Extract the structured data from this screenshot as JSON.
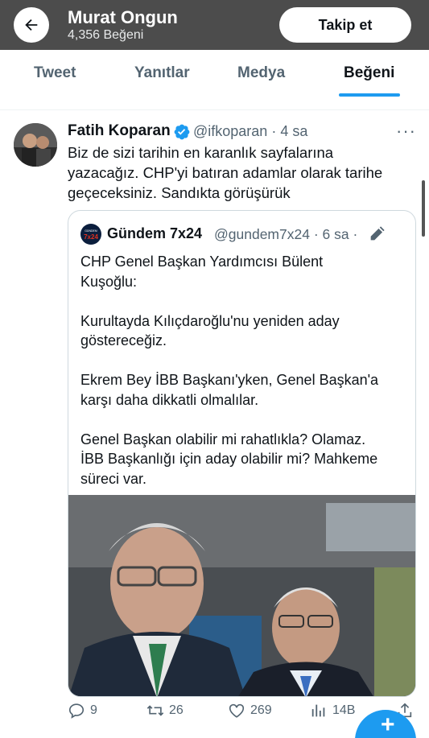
{
  "header": {
    "name": "Murat Ongun",
    "likes_count": "4,356 Beğeni",
    "follow_label": "Takip et"
  },
  "tabs": [
    "Tweet",
    "Yanıtlar",
    "Medya",
    "Beğeni"
  ],
  "active_tab": "Beğeni",
  "tweet": {
    "author_name": "Fatih Koparan",
    "handle_time": "@ifkoparan · 4 sa",
    "text_lines": [
      "Biz de sizi tarihin en karanlık sayfalarına",
      "yazacağız. CHP'yi batıran adamlar olarak tarihe",
      "geçeceksiniz. Sandıkta görüşürük"
    ],
    "quote": {
      "avatar_text_top": "GÜNDEM",
      "avatar_text_bottom": "7x24",
      "name": "Gündem 7x24",
      "handle_time": "@gundem7x24 · 6 sa ·",
      "paragraphs": [
        [
          "CHP Genel Başkan Yardımcısı Bülent",
          "Kuşoğlu:"
        ],
        [
          "Kurultayda Kılıçdaroğlu'nu yeniden aday",
          "göstereceğiz."
        ],
        [
          "Ekrem Bey İBB Başkanı'yken, Genel Başkan'a",
          "karşı daha dikkatli olmalılar."
        ],
        [
          "Genel Başkan olabilir mi rahatlıkla? Olamaz.",
          "İBB Başkanlığı için aday olabilir mi? Mahkeme",
          "süreci var."
        ]
      ]
    },
    "actions": {
      "replies": "9",
      "retweets": "26",
      "likes": "269",
      "views": "14B"
    }
  },
  "colors": {
    "accent": "#1d9bf0",
    "header_bg": "#4c4c4c",
    "secondary_text": "#536471"
  },
  "icons": [
    "back-arrow-icon",
    "verified-badge-icon",
    "more-icon",
    "edit-icon",
    "reply-icon",
    "retweet-icon",
    "like-icon",
    "views-icon",
    "share-icon",
    "compose-icon"
  ]
}
